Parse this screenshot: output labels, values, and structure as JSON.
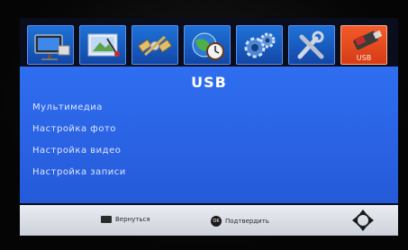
{
  "menu_tabs": [
    {
      "name": "picture",
      "label": ""
    },
    {
      "name": "image-adjust",
      "label": ""
    },
    {
      "name": "satellite",
      "label": ""
    },
    {
      "name": "time",
      "label": ""
    },
    {
      "name": "settings",
      "label": ""
    },
    {
      "name": "tools",
      "label": ""
    },
    {
      "name": "usb",
      "label": "USB"
    }
  ],
  "panel": {
    "title": "USB",
    "items": [
      {
        "label": "Мультимедиа"
      },
      {
        "label": "Настройка фото"
      },
      {
        "label": "Настройка видео"
      },
      {
        "label": "Настройка записи"
      }
    ]
  },
  "footer": {
    "back_label": "Вернуться",
    "ok_key": "OK",
    "confirm_label": "Подтвердить"
  },
  "colors": {
    "panel_blue": "#2f6ef0",
    "tab_blue": "#1f72d8",
    "tab_active": "#f25a2a",
    "footer_gray": "#dde1e8"
  }
}
